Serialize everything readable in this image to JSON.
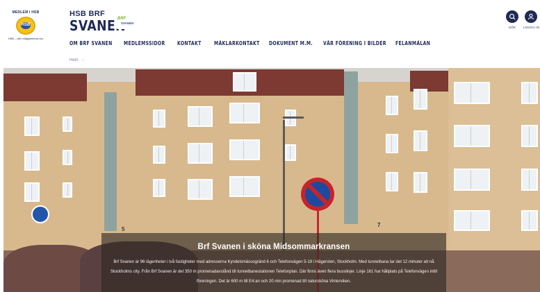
{
  "header": {
    "hsb_logo": {
      "top_text": "MEDLEM I HSB",
      "badge_text": "HSB",
      "tagline": "HSB – där möjligheterna bor"
    },
    "brand_line1": "HSB BRF",
    "brand_line2": "SVANEN",
    "svan_logo": {
      "line1": "BRF",
      "line2": "SVANEN"
    },
    "search_label": "SÖK",
    "login_label": "LOGGA IN",
    "accent_color": "#1f2a55"
  },
  "nav": {
    "items": [
      {
        "label": "OM BRF SVANEN"
      },
      {
        "label": "MEDLEMSSIDOR"
      },
      {
        "label": "KONTAKT"
      },
      {
        "label": "MÄKLARKONTAKT"
      },
      {
        "label": "DOKUMENT M.M."
      },
      {
        "label": "VÅR FÖRENING I BILDER"
      },
      {
        "label": "FELANMÄLAN"
      }
    ]
  },
  "breadcrumb": {
    "home": "Hem",
    "separator": "›"
  },
  "hero": {
    "title": "Brf Svanen i sköna Midsommarkransen",
    "body": "Brf Svanen är 96 lägenheter i två fastigheter med adresserna Kyndelsmässogränd 6 och Telefonvägen 5-19 i Hägersten, Stockholm. Med tunnelbana tar det 12 minuter att nå Stockholms city. Från Brf Svanen är det 350 m promenadavstånd till tunnelbanestationen Telefonplan. Där finns även flera busslinjer. Linje 161 har hållplats på Telefonvägen intill föreningen. Det är 600 m till E4:an och 20 min promenad till natursköna Vinterviken.",
    "house_number_left": "5",
    "house_number_right": "7"
  }
}
